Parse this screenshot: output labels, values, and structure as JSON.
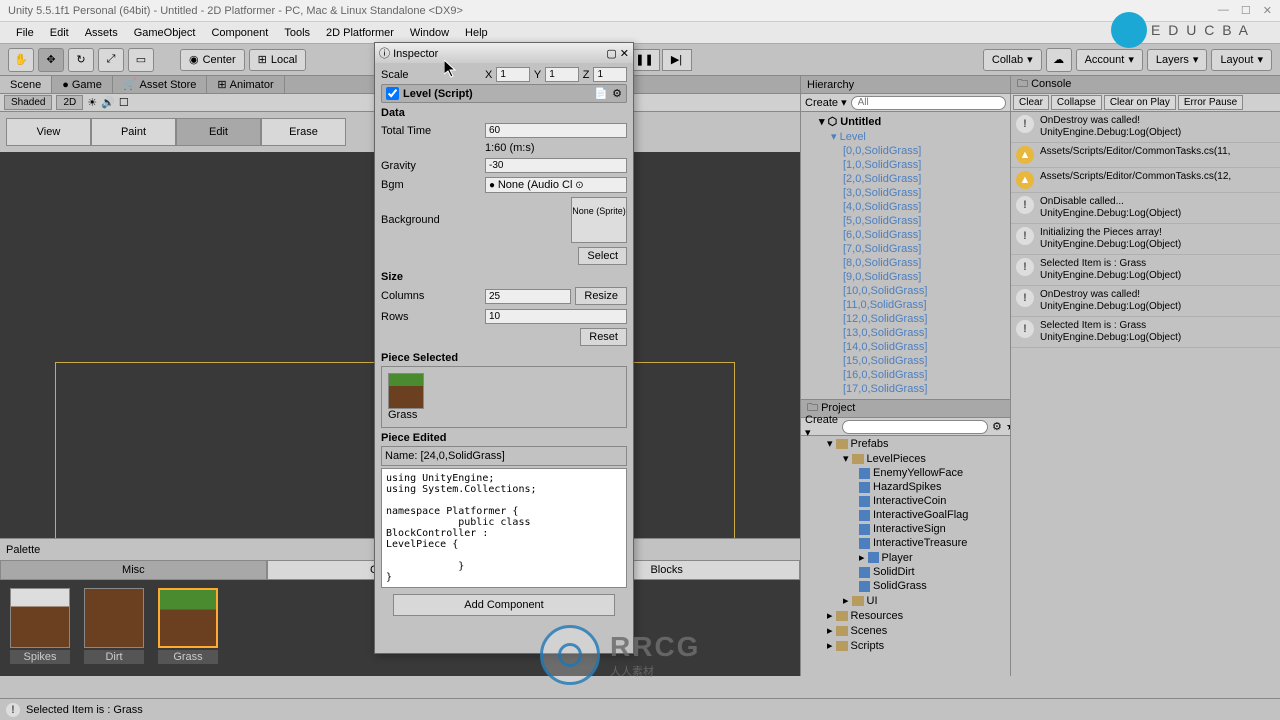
{
  "window": {
    "title": "Unity 5.5.1f1 Personal (64bit) - Untitled - 2D Platformer - PC, Mac & Linux Standalone <DX9>"
  },
  "menu": {
    "items": [
      "File",
      "Edit",
      "Assets",
      "GameObject",
      "Component",
      "Tools",
      "2D Platformer",
      "Window",
      "Help"
    ]
  },
  "toolbar": {
    "center": "Center",
    "local": "Local",
    "collab": "Collab",
    "account": "Account",
    "layers": "Layers",
    "layout": "Layout"
  },
  "scene": {
    "tabs": [
      "Scene",
      "Game",
      "Asset Store",
      "Animator"
    ],
    "shaded": "Shaded",
    "mode2d": "2D",
    "modes": [
      "View",
      "Paint",
      "Edit",
      "Erase"
    ],
    "active_mode": "Edit",
    "palette_title": "Palette",
    "palette_tabs": [
      "Misc",
      "Collectables",
      "Blocks"
    ],
    "palette_items": [
      "Spikes",
      "Dirt",
      "Grass"
    ]
  },
  "inspector": {
    "tab": "Inspector",
    "scale": "Scale",
    "x": "X",
    "xval": "1",
    "y": "Y",
    "yval": "1",
    "z": "Z",
    "zval": "1",
    "script_title": "Level (Script)",
    "data_hdr": "Data",
    "total_time_lbl": "Total Time",
    "total_time_val": "60",
    "time_fmt": "1:60 (m:s)",
    "gravity_lbl": "Gravity",
    "gravity_val": "-30",
    "bgm_lbl": "Bgm",
    "bgm_val": "None (Audio Cl",
    "background_lbl": "Background",
    "bg_val": "None (Sprite)",
    "select": "Select",
    "size_hdr": "Size",
    "columns_lbl": "Columns",
    "columns_val": "25",
    "rows_lbl": "Rows",
    "rows_val": "10",
    "resize": "Resize",
    "reset": "Reset",
    "piece_sel_hdr": "Piece Selected",
    "piece_sel_name": "Grass",
    "piece_edit_hdr": "Piece Edited",
    "piece_edit_name": "Name: [24,0,SolidGrass]",
    "code": "using UnityEngine;\nusing System.Collections;\n\nnamespace Platformer {\n            public class BlockController :\nLevelPiece {\n\n            }\n}",
    "add_component": "Add Component"
  },
  "hierarchy": {
    "title": "Hierarchy",
    "create": "Create",
    "all": "All",
    "root": "Untitled",
    "level": "Level",
    "items": [
      "[0,0,SolidGrass]",
      "[1,0,SolidGrass]",
      "[2,0,SolidGrass]",
      "[3,0,SolidGrass]",
      "[4,0,SolidGrass]",
      "[5,0,SolidGrass]",
      "[6,0,SolidGrass]",
      "[7,0,SolidGrass]",
      "[8,0,SolidGrass]",
      "[9,0,SolidGrass]",
      "[10,0,SolidGrass]",
      "[11,0,SolidGrass]",
      "[12,0,SolidGrass]",
      "[13,0,SolidGrass]",
      "[14,0,SolidGrass]",
      "[15,0,SolidGrass]",
      "[16,0,SolidGrass]",
      "[17,0,SolidGrass]"
    ]
  },
  "project": {
    "title": "Project",
    "create": "Create",
    "prefabs": "Prefabs",
    "levelpieces": "LevelPieces",
    "items": [
      "EnemyYellowFace",
      "HazardSpikes",
      "InteractiveCoin",
      "InteractiveGoalFlag",
      "InteractiveSign",
      "InteractiveTreasure",
      "Player",
      "SolidDirt",
      "SolidGrass"
    ],
    "ui": "UI",
    "resources": "Resources",
    "scenes": "Scenes",
    "scripts": "Scripts"
  },
  "console": {
    "title": "Console",
    "buttons": [
      "Clear",
      "Collapse",
      "Clear on Play",
      "Error Pause"
    ],
    "logs": [
      {
        "type": "info",
        "l1": "OnDestroy was called!",
        "l2": "UnityEngine.Debug:Log(Object)"
      },
      {
        "type": "warn",
        "l1": "Assets/Scripts/Editor/CommonTasks.cs(11,",
        "l2": ""
      },
      {
        "type": "warn",
        "l1": "Assets/Scripts/Editor/CommonTasks.cs(12,",
        "l2": ""
      },
      {
        "type": "info",
        "l1": "OnDisable called...",
        "l2": "UnityEngine.Debug:Log(Object)"
      },
      {
        "type": "info",
        "l1": "Initializing the Pieces array!",
        "l2": "UnityEngine.Debug:Log(Object)"
      },
      {
        "type": "info",
        "l1": "Selected Item is : Grass",
        "l2": "UnityEngine.Debug:Log(Object)"
      },
      {
        "type": "info",
        "l1": "OnDestroy was called!",
        "l2": "UnityEngine.Debug:Log(Object)"
      },
      {
        "type": "info",
        "l1": "Selected Item is : Grass",
        "l2": "UnityEngine.Debug:Log(Object)"
      }
    ]
  },
  "status": {
    "text": "Selected Item is : Grass"
  },
  "brand": {
    "educba": "E D U C B A",
    "rrcg": "RRCG",
    "rrcg_sub": "人人素材"
  }
}
